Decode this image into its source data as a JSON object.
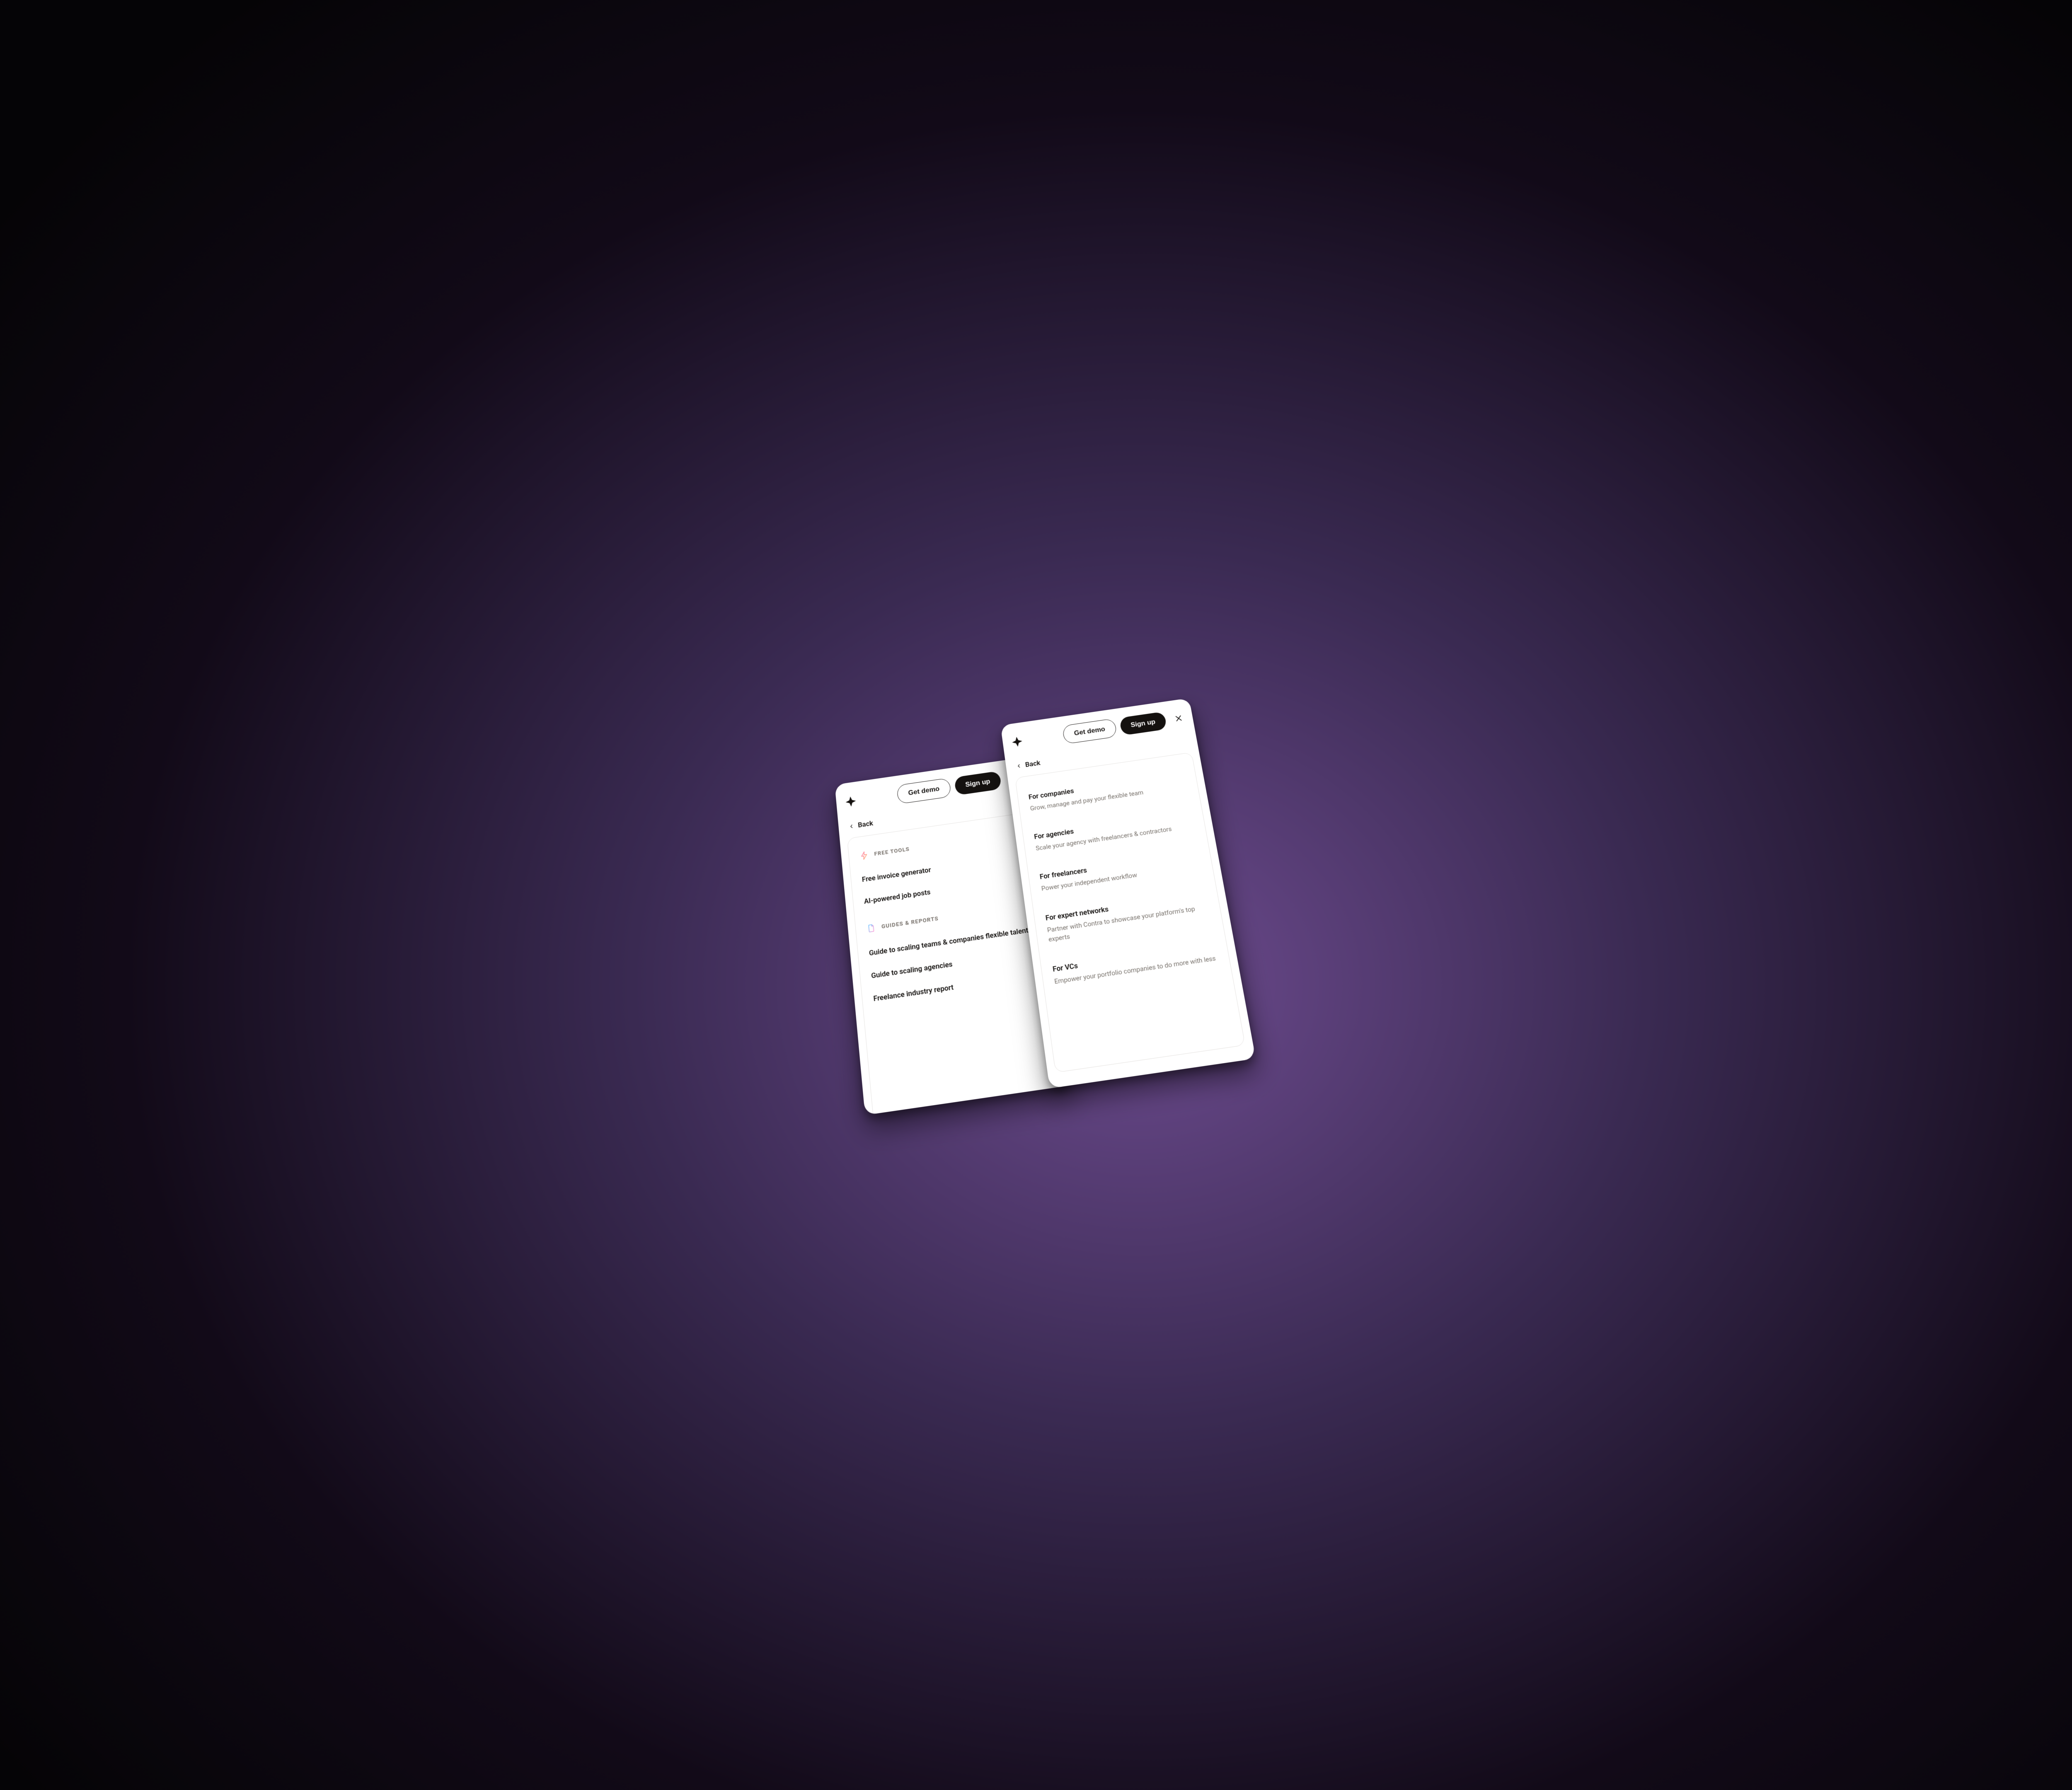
{
  "header": {
    "get_demo": "Get demo",
    "sign_up": "Sign up",
    "back": "Back"
  },
  "left_panel": {
    "section1_label": "FREE TOOLS",
    "items1": [
      "Free invoice generator",
      "AI-powered job posts"
    ],
    "section2_label": "GUIDES & REPORTS",
    "items2": [
      "Guide to scaling teams & companies flexible talent",
      "Guide to scaling agencies",
      "Freelance industry report"
    ]
  },
  "right_panel": {
    "items": [
      {
        "title": "For companies",
        "sub": "Grow, manage and pay your flexible team"
      },
      {
        "title": "For agencies",
        "sub": "Scale your agency with freelancers & contractors"
      },
      {
        "title": "For freelancers",
        "sub": "Power your independent workflow"
      },
      {
        "title": "For expert networks",
        "sub": "Partner with Contra to showcase your platform's top experts"
      },
      {
        "title": "For VCs",
        "sub": "Empower your portfolio companies to do more with less"
      }
    ]
  }
}
